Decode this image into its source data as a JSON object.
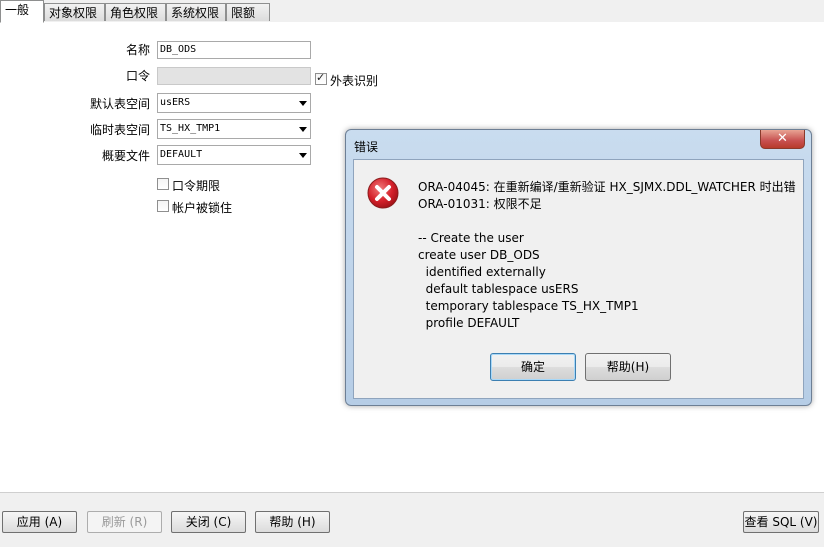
{
  "tabs": [
    "一般",
    "对象权限",
    "角色权限",
    "系统权限",
    "限额"
  ],
  "form": {
    "name_label": "名称",
    "name_value": "DB_ODS",
    "password_label": "口令",
    "external_label": "外表识别",
    "default_ts_label": "默认表空间",
    "default_ts_value": "usERS",
    "temp_ts_label": "临时表空间",
    "temp_ts_value": "TS_HX_TMP1",
    "profile_label": "概要文件",
    "profile_value": "DEFAULT",
    "pw_expire_label": "口令期限",
    "locked_label": "帐户被锁住"
  },
  "bottom": {
    "apply": "应用 (A)",
    "refresh": "刷新 (R)",
    "close": "关闭 (C)",
    "help": "帮助 (H)",
    "view_sql": "查看 SQL (V)"
  },
  "dialog": {
    "title": "错误",
    "close_glyph": "✕",
    "line1": "ORA-04045: 在重新编译/重新验证 HX_SJMX.DDL_WATCHER 时出错",
    "line2": "ORA-01031: 权限不足",
    "sql_lines": [
      "-- Create the user",
      "create user DB_ODS",
      "  identified externally",
      "  default tablespace usERS",
      "  temporary tablespace TS_HX_TMP1",
      "  profile DEFAULT"
    ],
    "ok": "确定",
    "help": "帮助(H)"
  },
  "colors": {
    "error_red": "#d4202a",
    "dialog_frame": "#b9d1ea"
  }
}
